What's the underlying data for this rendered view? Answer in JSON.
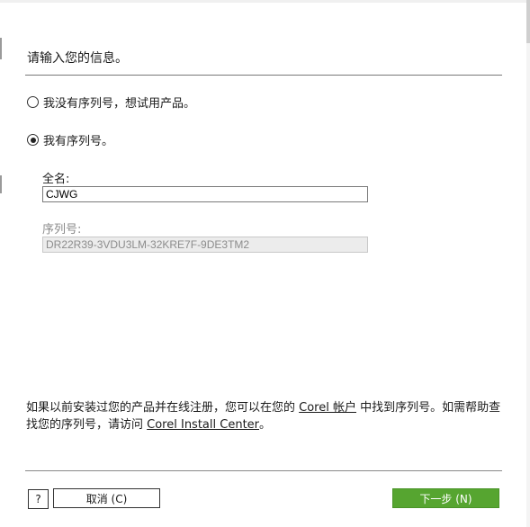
{
  "dialog": {
    "prompt": "请输入您的信息。",
    "options": {
      "no_serial_label": "我没有序列号，想试用产品。",
      "has_serial_label": "我有序列号。",
      "selected": "has_serial"
    },
    "fields": {
      "fullname_label": "全名:",
      "fullname_value": "CJWG",
      "serial_label": "序列号:",
      "serial_value": "DR22R39-3VDU3LM-32KRE7F-9DE3TM2"
    },
    "info": {
      "part1": "如果以前安装过您的产品并在线注册，您可以在您的",
      "link1": "Corel 帐户",
      "part2": "中找到序列号。如需帮助查找您的序列号，请访问",
      "link2": "Corel Install Center",
      "part3": "。"
    },
    "buttons": {
      "help": "?",
      "cancel": "取消 (C)",
      "next": "下一步 (N)"
    }
  },
  "colors": {
    "next_button_bg": "#56a530",
    "divider": "#777777"
  }
}
